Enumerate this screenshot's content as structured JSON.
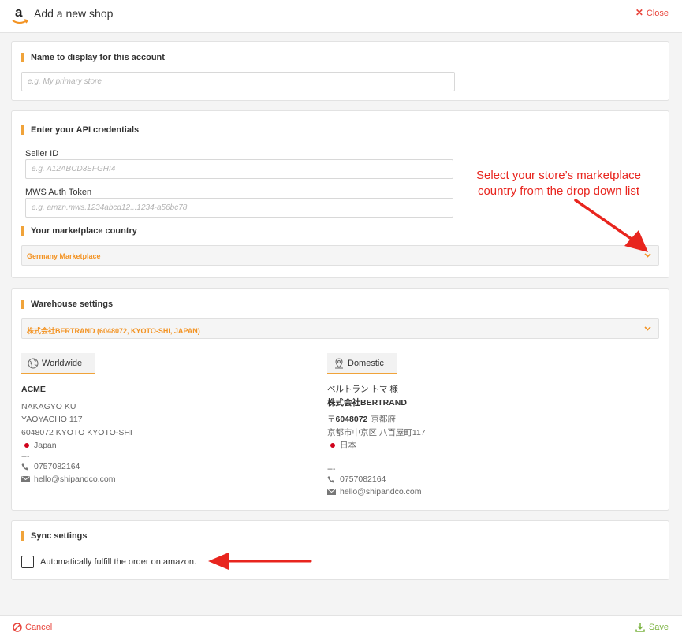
{
  "header": {
    "title": "Add a new shop",
    "close_label": "Close"
  },
  "display_name": {
    "heading": "Name to display for this account",
    "placeholder": "e.g. My primary store",
    "value": ""
  },
  "api": {
    "heading": "Enter your API credentials",
    "seller_label": "Seller ID",
    "seller_placeholder": "e.g. A12ABCD3EFGHI4",
    "token_label": "MWS Auth Token",
    "token_placeholder": "e.g. amzn.mws.1234abcd12...1234-a56bc78",
    "country_heading": "Your marketplace country",
    "country_selected": "Germany Marketplace"
  },
  "annotation": {
    "line1": "Select your store’s marketplace",
    "line2": "country from the drop down list"
  },
  "warehouse": {
    "heading": "Warehouse settings",
    "selected": "株式会社BERTRAND (6048072, KYOTO-SHI, JAPAN)",
    "worldwide": {
      "tab_label": "Worldwide",
      "name": "ACME",
      "line1": "NAKAGYO KU",
      "line2": "YAOYACHO 117",
      "line3": "6048072 KYOTO KYOTO-SHI",
      "country": "Japan",
      "separator": "---",
      "phone": "0757082164",
      "email": "hello@shipandco.com"
    },
    "domestic": {
      "tab_label": "Domestic",
      "contact": "ベルトラン トマ 様",
      "company": "株式会社BERTRAND",
      "postal_prefix": "〒",
      "postal": "6048072",
      "prefecture": "京都府",
      "street": "京都市中京区 八百屋町117",
      "country": "日本",
      "separator": "---",
      "phone": "0757082164",
      "email": "hello@shipandco.com"
    }
  },
  "sync": {
    "heading": "Sync settings",
    "auto_fulfill_label": "Automatically fulfill the order on amazon.",
    "auto_fulfill_checked": false
  },
  "footer": {
    "cancel_label": "Cancel",
    "save_label": "Save"
  },
  "colors": {
    "accent": "#f0a33a",
    "selected_text": "#f39323",
    "danger": "#e8453c",
    "success": "#7cb342",
    "annotation": "#e8251e"
  }
}
